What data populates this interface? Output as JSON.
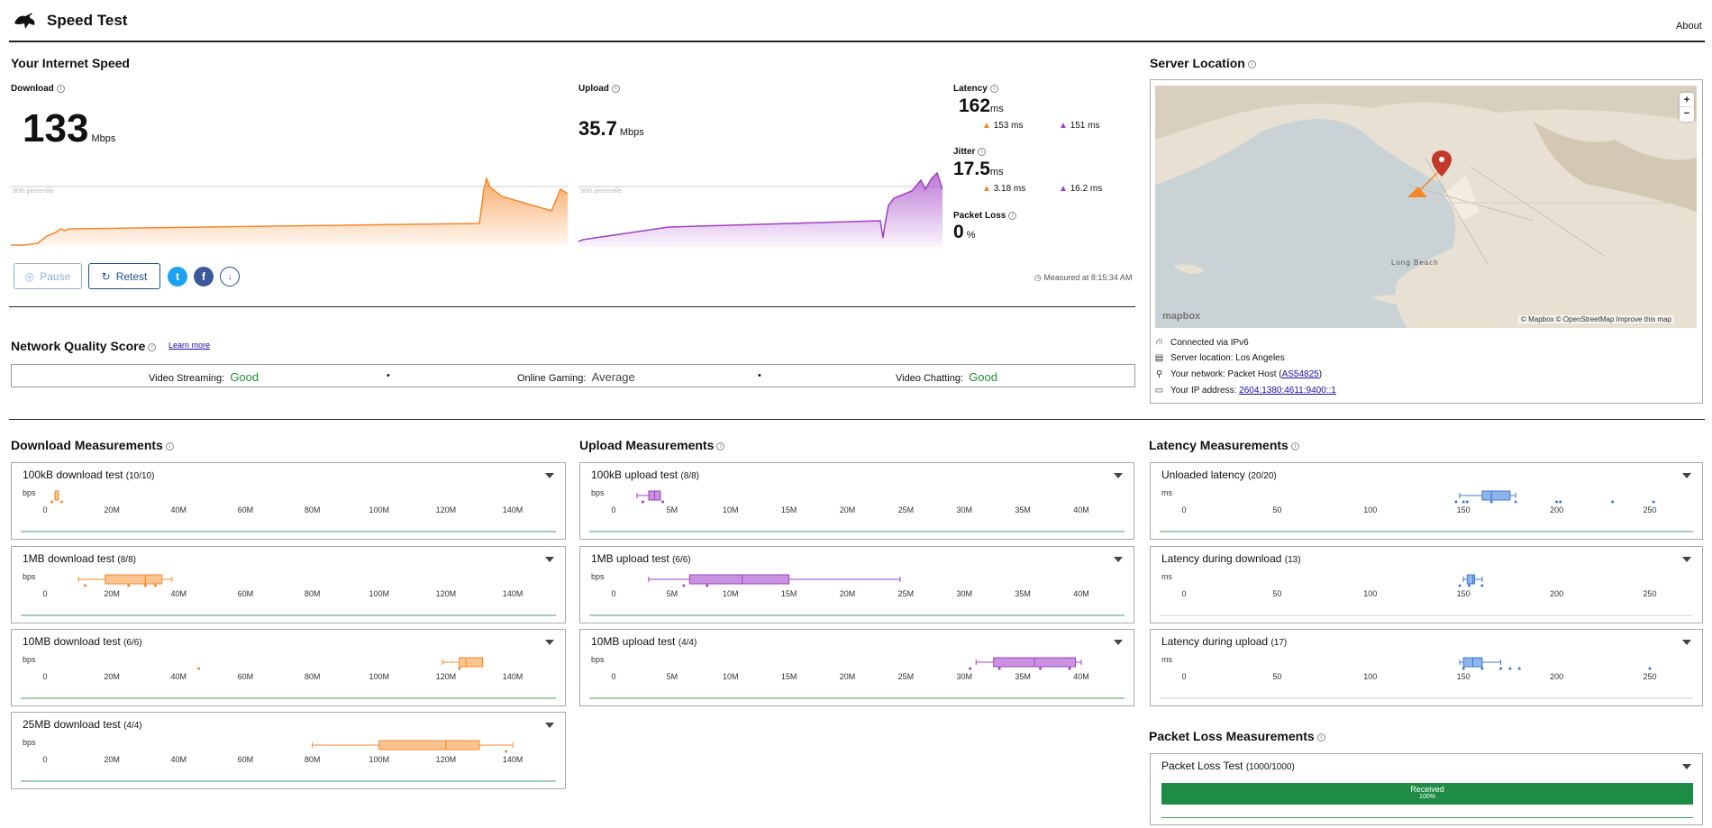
{
  "app": {
    "title": "Speed Test",
    "about": "About"
  },
  "speed": {
    "heading": "Your Internet Speed",
    "download": {
      "label": "Download",
      "value": "133",
      "unit": "Mbps",
      "percentile_label": "90th percentile"
    },
    "upload": {
      "label": "Upload",
      "value": "35.7",
      "unit": "Mbps",
      "percentile_label": "90th percentile"
    },
    "latency": {
      "label": "Latency",
      "value": "162",
      "unit": "ms",
      "down_value": "153 ms",
      "up_value": "151 ms"
    },
    "jitter": {
      "label": "Jitter",
      "value": "17.5",
      "unit": "ms",
      "down_value": "3.18 ms",
      "up_value": "16.2 ms"
    },
    "packet_loss": {
      "label": "Packet Loss",
      "value": "0",
      "unit": "%"
    },
    "pause_label": "Pause",
    "retest_label": "Retest",
    "measured_at": "Measured at 8:15:34 AM"
  },
  "quality": {
    "heading": "Network Quality Score",
    "learn_more": "Learn more",
    "items": [
      {
        "label": "Video Streaming:",
        "value": "Good"
      },
      {
        "label": "Online Gaming:",
        "value": "Average"
      },
      {
        "label": "Video Chatting:",
        "value": "Good"
      }
    ]
  },
  "server": {
    "heading": "Server Location",
    "map_credit": "© Mapbox © OpenStreetMap",
    "improve": "Improve this map",
    "mapbox_logo": "mapbox",
    "city_label": "Long Beach",
    "zoom_in": "+",
    "zoom_out": "−",
    "connected": "Connected via IPv6",
    "location": "Server location: Los Angeles",
    "network_prefix": "Your network: Packet Host (",
    "network_link": "AS54825",
    "network_suffix": ")",
    "ip_prefix": "Your IP address: ",
    "ip_link": "2604:1380:4611:9400::1"
  },
  "download_measurements": {
    "heading": "Download Measurements",
    "axis_unit": "bps",
    "ticks": [
      "0",
      "20M",
      "40M",
      "60M",
      "80M",
      "100M",
      "120M",
      "140M"
    ],
    "tests": [
      {
        "title": "100kB download test",
        "count": "(10/10)"
      },
      {
        "title": "1MB download test",
        "count": "(8/8)"
      },
      {
        "title": "10MB download test",
        "count": "(6/6)"
      },
      {
        "title": "25MB download test",
        "count": "(4/4)"
      }
    ]
  },
  "upload_measurements": {
    "heading": "Upload Measurements",
    "axis_unit": "bps",
    "ticks": [
      "0",
      "5M",
      "10M",
      "15M",
      "20M",
      "25M",
      "30M",
      "35M",
      "40M"
    ],
    "tests": [
      {
        "title": "100kB upload test",
        "count": "(8/8)"
      },
      {
        "title": "1MB upload test",
        "count": "(6/6)"
      },
      {
        "title": "10MB upload test",
        "count": "(4/4)"
      }
    ]
  },
  "latency_measurements": {
    "heading": "Latency Measurements",
    "axis_unit": "ms",
    "ticks": [
      "0",
      "50",
      "100",
      "150",
      "200",
      "250"
    ],
    "tests": [
      {
        "title": "Unloaded latency",
        "count": "(20/20)"
      },
      {
        "title": "Latency during download",
        "count": "(13)"
      },
      {
        "title": "Latency during upload",
        "count": "(17)"
      }
    ]
  },
  "packet_loss_measurements": {
    "heading": "Packet Loss Measurements",
    "test_title": "Packet Loss Test",
    "test_count": "(1000/1000)",
    "bar_label": "Received",
    "bar_pct": "100%",
    "received_fraction": 1.0
  },
  "colors": {
    "download": "#f5872a",
    "upload": "#a13fc6",
    "latency": "#3b78d8",
    "good": "#228b3a",
    "received": "#1e8c45"
  }
}
